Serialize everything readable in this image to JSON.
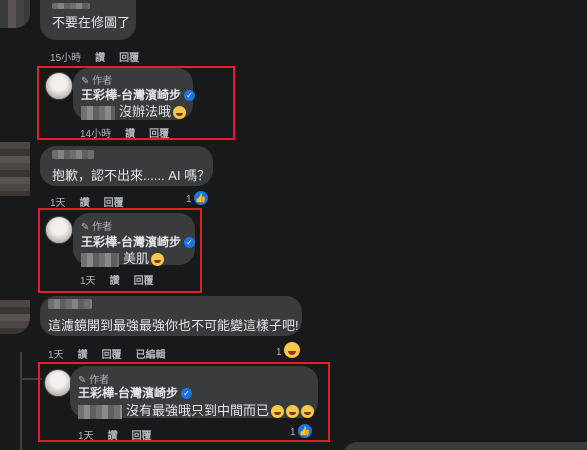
{
  "comments": [
    {
      "text": "不要在修圖了",
      "time": "15小時",
      "actions": [
        "讚",
        "回覆"
      ]
    },
    {
      "author_tag": "作者",
      "author": "王彩樺-台灣濱崎步",
      "text": "沒辦法哦",
      "time": "14小時",
      "actions": [
        "讚",
        "回覆"
      ]
    },
    {
      "text": "抱歉，認不出來...... AI 嗎？",
      "time": "1天",
      "actions": [
        "讚",
        "回覆"
      ],
      "reaction_count": "1",
      "reaction_icon": "like-icon"
    },
    {
      "author_tag": "作者",
      "author": "王彩樺-台灣濱崎步",
      "text": "美肌",
      "time": "1天",
      "actions": [
        "讚",
        "回覆"
      ]
    },
    {
      "text": "這濾鏡開到最強最強你也不可能變這樣子吧!",
      "time": "1天",
      "actions": [
        "讚",
        "回覆",
        "已編輯"
      ],
      "reaction_count": "1",
      "reaction_icon": "haha-icon"
    },
    {
      "author_tag": "作者",
      "author": "王彩樺-台灣濱崎步",
      "text": "沒有最強哦只到中間而已",
      "time": "1天",
      "actions": [
        "讚",
        "回覆"
      ],
      "reaction_count": "1",
      "reaction_icon": "like-icon"
    }
  ],
  "colors": {
    "highlight_box": "#e0202a",
    "bubble": "#3a3b3c",
    "verified": "#1b74e4"
  }
}
